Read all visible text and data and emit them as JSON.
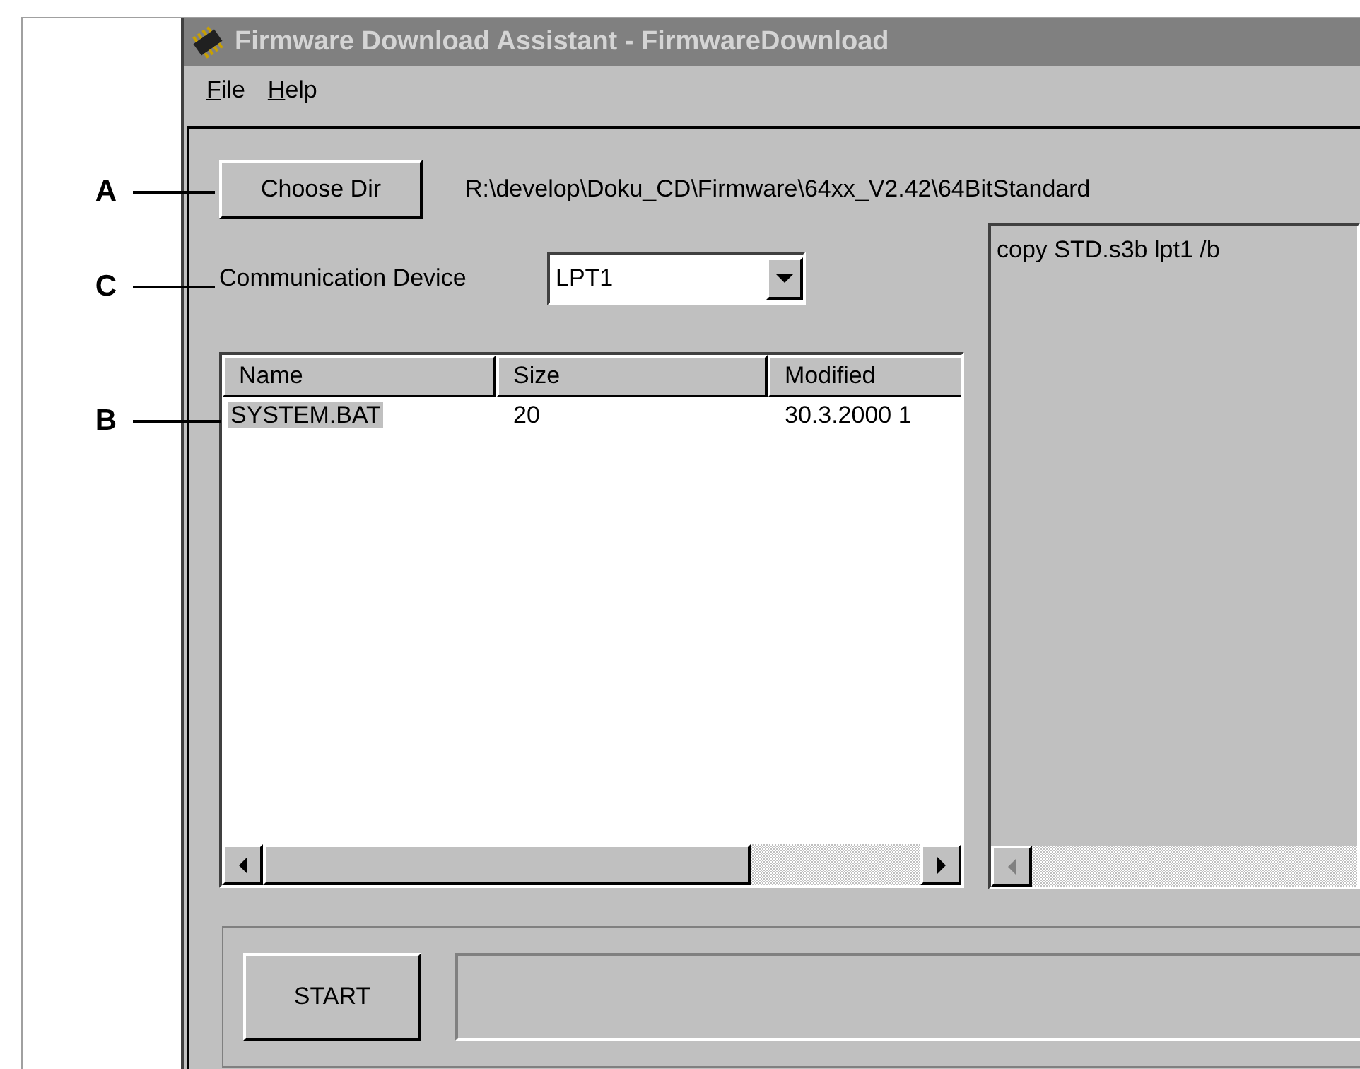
{
  "window": {
    "title": "Firmware Download Assistant - FirmwareDownload"
  },
  "menu": [
    {
      "label": "File"
    },
    {
      "label": "Help"
    }
  ],
  "choose_dir": {
    "label": "Choose Dir",
    "path": "R:\\develop\\Doku_CD\\Firmware\\64xx_V2.42\\64BitStandard"
  },
  "device": {
    "label": "Communication Device",
    "value": "LPT1"
  },
  "file_list": {
    "columns": [
      "Name",
      "Size",
      "Modified"
    ],
    "rows": [
      {
        "cells": [
          "SYSTEM.BAT",
          "20",
          "30.3.2000 1"
        ],
        "selected": true
      }
    ]
  },
  "output": {
    "lines": [
      "copy STD.s3b lpt1 /b"
    ]
  },
  "start": {
    "label": "START"
  },
  "callouts": [
    {
      "label": "A"
    },
    {
      "label": "C"
    },
    {
      "label": "B"
    }
  ]
}
